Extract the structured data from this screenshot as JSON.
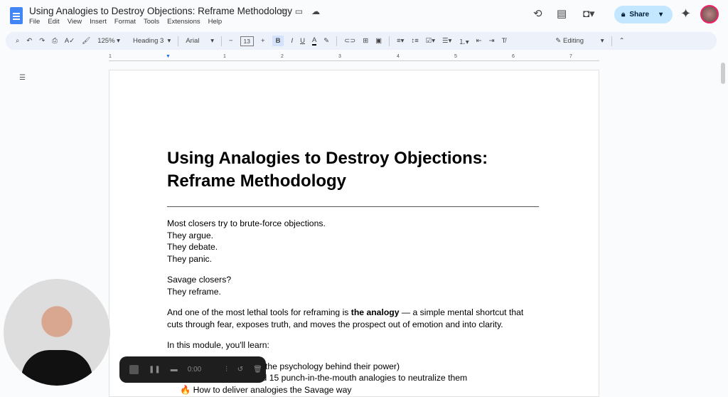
{
  "doc": {
    "title": "Using Analogies to Destroy Objections: Reframe Methodology",
    "menu": [
      "File",
      "Edit",
      "View",
      "Insert",
      "Format",
      "Tools",
      "Extensions",
      "Help"
    ],
    "share_label": "Share"
  },
  "toolbar": {
    "zoom": "125%",
    "style": "Heading 3",
    "font": "Arial",
    "font_size": "13",
    "bold": "B",
    "italic": "I",
    "underline": "U",
    "text_color": "A",
    "mode": "Editing"
  },
  "ruler": [
    "1",
    "1",
    "2",
    "3",
    "4",
    "5",
    "6",
    "7"
  ],
  "content": {
    "heading": "Using Analogies to Destroy Objections: Reframe Methodology",
    "p1": [
      "Most closers try to brute-force objections.",
      "They argue.",
      "They debate.",
      "They panic."
    ],
    "p2": [
      "Savage closers?",
      "They reframe."
    ],
    "p3_pre": "And one of the most lethal tools for reframing is ",
    "p3_bold": "the analogy",
    "p3_post": " — a simple mental shortcut that cuts through fear, exposes truth, and moves the prospect out of emotion and into clarity.",
    "p4": "In this module, you'll learn:",
    "list": [
      "the psychology behind their power)",
      "and 15 punch-in-the-mouth analogies to neutralize them",
      "How to deliver analogies the Savage way"
    ]
  },
  "recorder": {
    "time": "0:00"
  }
}
